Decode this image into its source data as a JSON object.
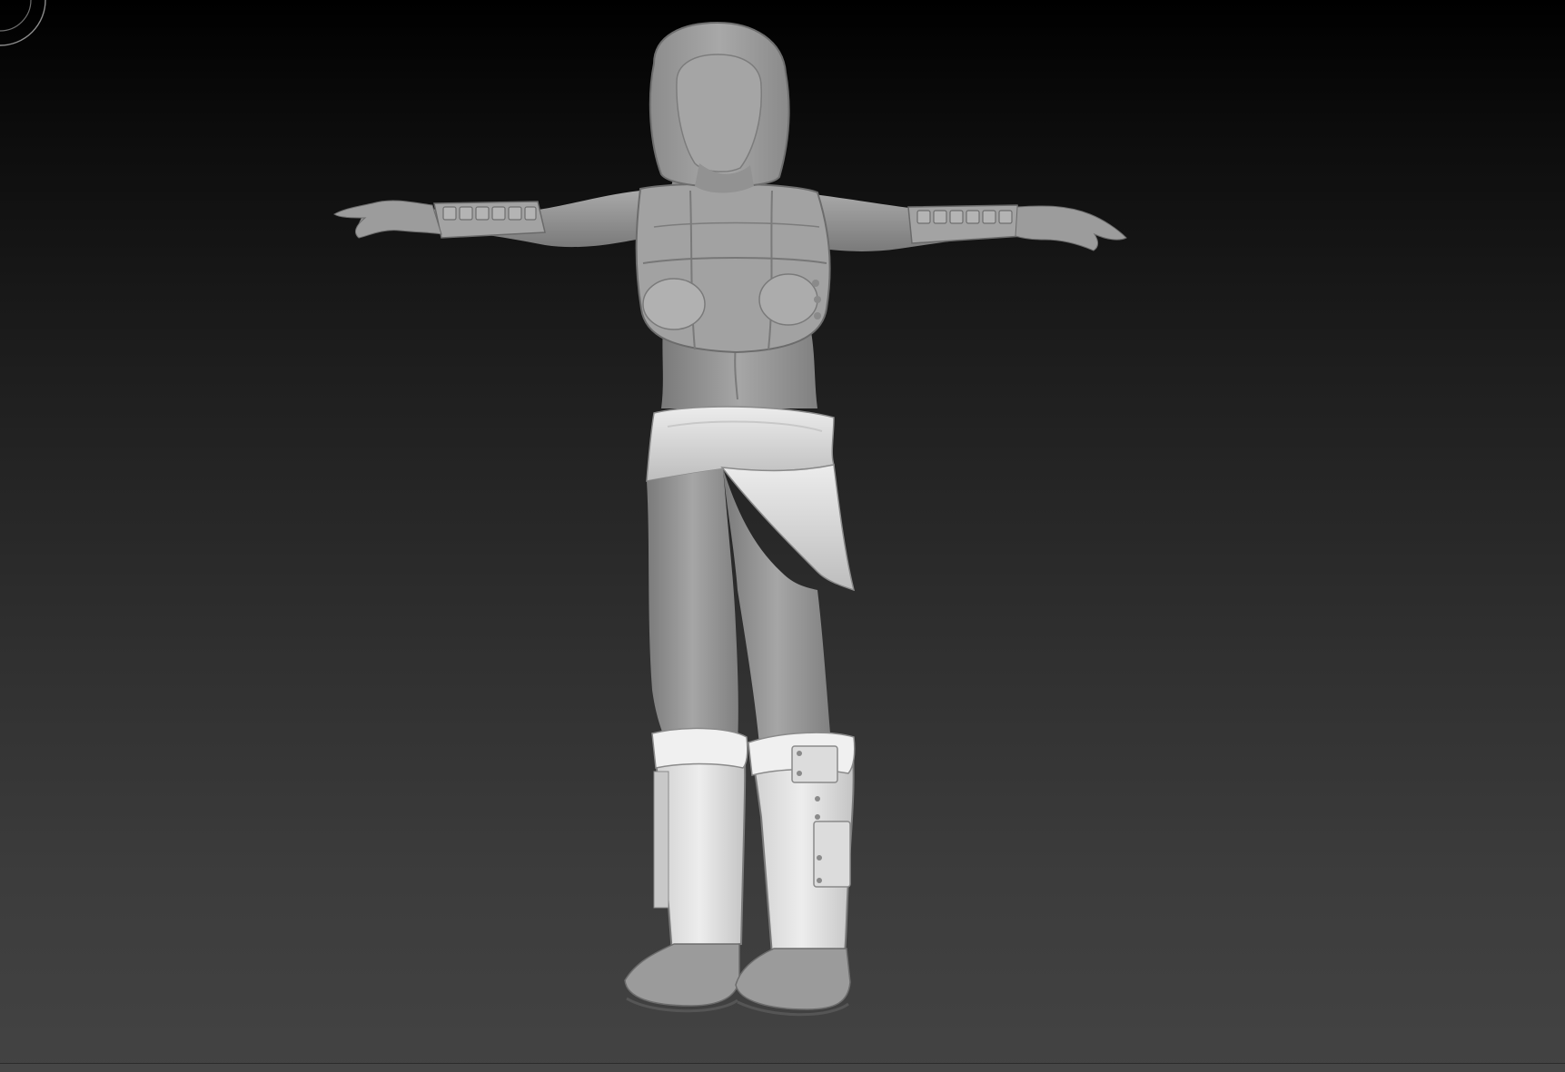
{
  "viewport": {
    "background_top": "#000000",
    "background_bottom": "#434343",
    "clay_color": "#9a9a9a",
    "clay_highlight": "#d8d8d8",
    "clay_shadow": "#5e5e5e"
  },
  "gizmo": {
    "icon": "orientation-gizmo-icon"
  },
  "model": {
    "pose": "T-pose",
    "parts": [
      "hood",
      "vest",
      "bracers",
      "hip-cloth",
      "pants",
      "boots"
    ]
  }
}
